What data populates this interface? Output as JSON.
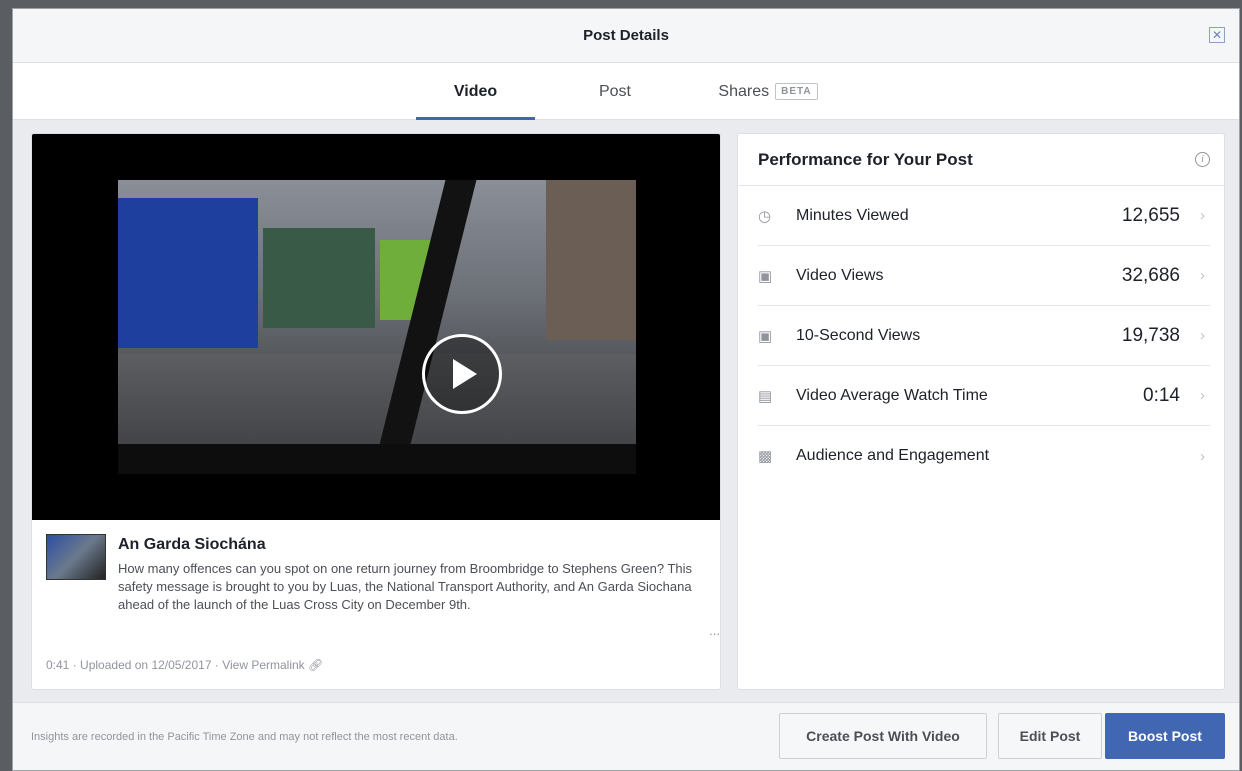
{
  "dialog": {
    "title": "Post Details",
    "close_icon": "close-icon"
  },
  "tabs": [
    {
      "label": "Video",
      "active": true
    },
    {
      "label": "Post",
      "active": false
    },
    {
      "label": "Shares",
      "badge": "BETA",
      "active": false
    }
  ],
  "video": {
    "play_icon": "play-icon"
  },
  "post": {
    "page_name": "An Garda Siochána",
    "text": "How many offences can you spot on one return journey from Broombridge to Stephens Green? This safety message is brought to you by Luas, the National Transport Authority, and An Garda Siochana ahead of the launch of the Luas Cross City on December 9th.",
    "ellipsis": "...",
    "duration": "0:41",
    "separator": "·",
    "uploaded": "Uploaded on 12/05/2017",
    "permalink": "View Permalink"
  },
  "performance": {
    "title": "Performance for Your Post",
    "info_icon": "info-icon",
    "metrics": [
      {
        "icon": "clock-icon",
        "label": "Minutes Viewed",
        "value": "12,655"
      },
      {
        "icon": "video-camera-icon",
        "label": "Video Views",
        "value": "32,686"
      },
      {
        "icon": "video-camera-icon",
        "label": "10-Second Views",
        "value": "19,738"
      },
      {
        "icon": "film-strip-icon",
        "label": "Video Average Watch Time",
        "value": "0:14"
      },
      {
        "icon": "people-icon",
        "label": "Audience and Engagement",
        "value": ""
      }
    ]
  },
  "footer": {
    "note": "Insights are recorded in the Pacific Time Zone and may not reflect the most recent data.",
    "create_label": "Create Post With Video",
    "edit_label": "Edit Post",
    "boost_label": "Boost Post"
  },
  "colors": {
    "accent": "#4267b2",
    "background": "#e9ebee"
  }
}
